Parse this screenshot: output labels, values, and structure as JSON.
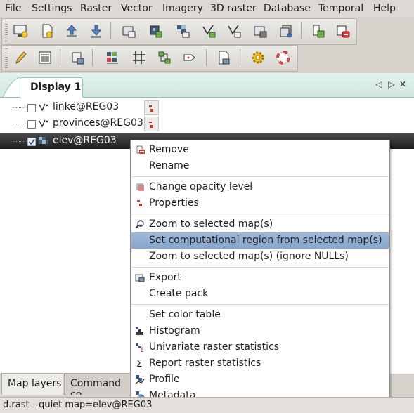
{
  "menubar": {
    "items": [
      "File",
      "Settings",
      "Raster",
      "Vector",
      "Imagery",
      "3D raster",
      "Database",
      "Temporal",
      "Help"
    ]
  },
  "toolbar1": {
    "buttons": [
      "new-display-icon",
      "new-workspace-icon",
      "open-workspace-icon",
      "save-workspace-icon",
      "add-raster-icon",
      "add-multiple-rasters-icon",
      "add-raster-overlay-icon",
      "add-vector-icon",
      "add-multiple-vectors-icon",
      "add-vector-overlay-icon",
      "add-group-icon",
      "add-overlay-icon",
      "remove-layer-icon"
    ]
  },
  "toolbar2": {
    "buttons": [
      "editor-pencil-icon",
      "attribute-table-icon",
      "georectifier-icon",
      "modeler-icon",
      "grid-icon",
      "workflow-icon",
      "map-composer-icon",
      "import-icon",
      "settings-gear-icon",
      "help-lifebuoy-icon"
    ]
  },
  "notebook": {
    "tab_label": "Display 1",
    "controls": [
      "◁",
      "▷",
      "✕"
    ]
  },
  "layers": [
    {
      "label": "linke@REG03",
      "checked": false,
      "selected": false,
      "icon": "vector-layer-icon"
    },
    {
      "label": "provinces@REG03",
      "checked": false,
      "selected": false,
      "icon": "vector-layer-icon"
    },
    {
      "label": "elev@REG03",
      "checked": true,
      "selected": true,
      "icon": "raster-layer-icon"
    }
  ],
  "context_menu": {
    "groups": [
      [
        {
          "label": "Remove",
          "icon": "remove-icon"
        },
        {
          "label": "Rename",
          "icon": ""
        }
      ],
      [
        {
          "label": "Change opacity level",
          "icon": "opacity-icon"
        },
        {
          "label": "Properties",
          "icon": "properties-icon"
        }
      ],
      [
        {
          "label": "Zoom to selected map(s)",
          "icon": "zoom-icon"
        },
        {
          "label": "Set computational region from selected map(s)",
          "icon": "",
          "highlighted": true
        },
        {
          "label": "Zoom to selected map(s) (ignore NULLs)",
          "icon": ""
        }
      ],
      [
        {
          "label": "Export",
          "icon": "export-icon"
        },
        {
          "label": "Create pack",
          "icon": ""
        }
      ],
      [
        {
          "label": "Set color table",
          "icon": ""
        },
        {
          "label": "Histogram",
          "icon": "histogram-icon"
        },
        {
          "label": "Univariate raster statistics",
          "icon": "univariate-stats-icon"
        },
        {
          "label": "Report raster statistics",
          "icon": "sigma-icon"
        },
        {
          "label": "Profile",
          "icon": "profile-icon"
        },
        {
          "label": "Metadata",
          "icon": "metadata-icon"
        }
      ]
    ]
  },
  "bottom_tabs": [
    {
      "label": "Map layers",
      "active": true
    },
    {
      "label": "Command co",
      "active": false
    }
  ],
  "statusbar": {
    "text": "d.rast --quiet map=elev@REG03"
  },
  "colors": {
    "highlight": "#8fabd3",
    "tab_strip": "#d6ede4",
    "selected_row": "#2b2b2b"
  }
}
